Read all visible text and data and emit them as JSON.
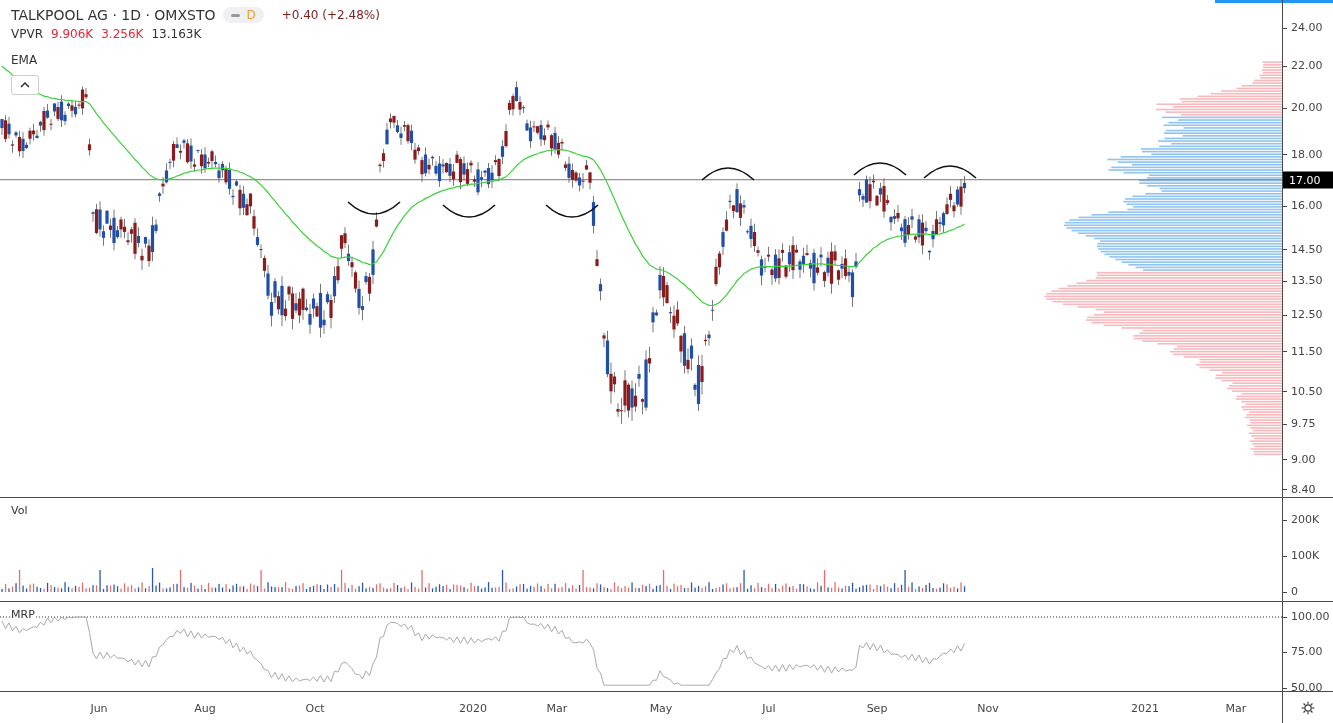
{
  "header": {
    "title": "TALKPOOL AG · 1D · OMXSTO",
    "badge": "D",
    "change": "+0.40 (+2.48%)"
  },
  "vpvr": {
    "label": "VPVR",
    "values": [
      {
        "text": "9.906K",
        "color": "#e0283c"
      },
      {
        "text": "3.256K",
        "color": "#e0283c"
      },
      {
        "text": "13.163K",
        "color": "#333333"
      }
    ]
  },
  "ema": {
    "label": "EMA"
  },
  "price_axis": {
    "ticks": [
      "24.00",
      "22.00",
      "20.00",
      "18.00",
      "16.00",
      "14.50",
      "13.50",
      "12.50",
      "11.50",
      "10.50",
      "9.75",
      "9.00",
      "8.40"
    ],
    "current": "17.00"
  },
  "volume_pane": {
    "label": "Vol",
    "ticks": [
      "200K",
      "100K",
      "0"
    ]
  },
  "mrp_pane": {
    "label": "MRP",
    "ticks": [
      "100.00",
      "75.00",
      "50.00"
    ]
  },
  "time_axis": {
    "labels": [
      "Jun",
      "Aug",
      "Oct",
      "2020",
      "Mar",
      "May",
      "Jul",
      "Sep",
      "Nov",
      "2021",
      "Mar"
    ]
  }
}
